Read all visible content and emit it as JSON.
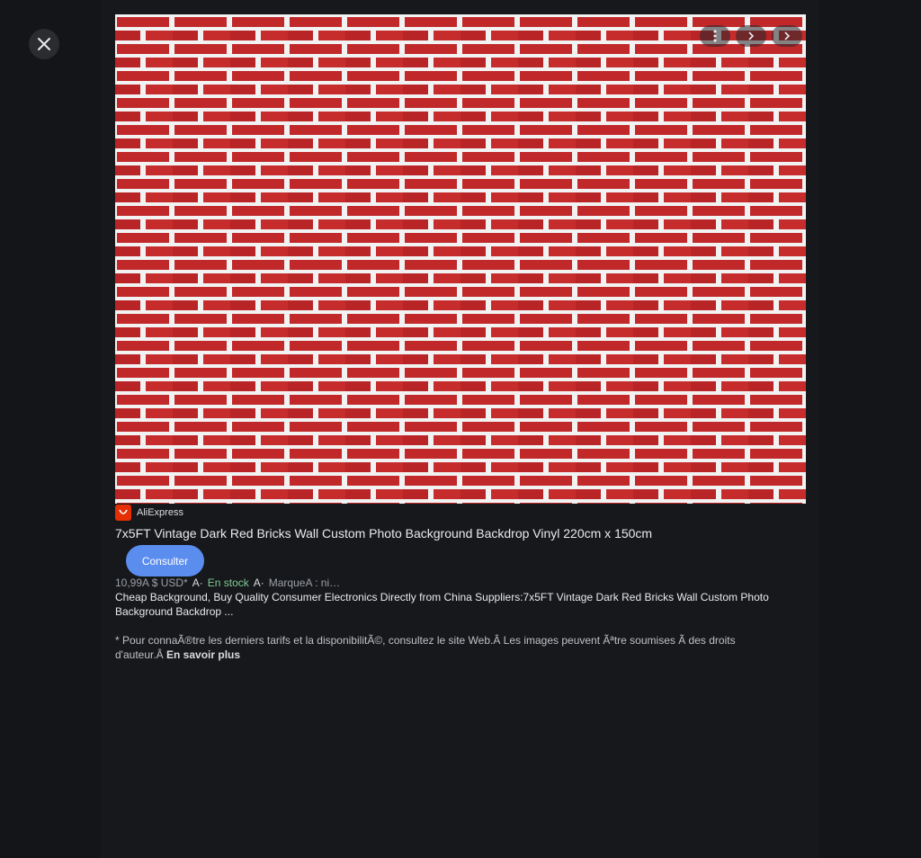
{
  "viewer": {
    "close_icon": "close-icon",
    "image_controls": [
      {
        "name": "more-options",
        "icon": "vertical-dots-icon"
      },
      {
        "name": "share",
        "icon": "chevron-right-icon"
      },
      {
        "name": "next",
        "icon": "chevron-right-icon"
      }
    ]
  },
  "result": {
    "source": "AliExpress",
    "source_icon": "aliexpress-logo-icon",
    "title": "7x5FT Vintage Dark Red Bricks Wall Custom Photo Background Backdrop Vinyl 220cm x 150cm",
    "visit_label": "Consulter",
    "price": "10,99A $ USD*",
    "sep1": "A·",
    "stock": "En stock",
    "sep2": "A·",
    "brand": "MarqueA : ni…",
    "description": "Cheap Background, Buy Quality Consumer Electronics Directly from China Suppliers:7x5FT Vintage Dark Red Bricks Wall Custom Photo Background Backdrop ...",
    "disclaimer": "* Pour connaÃ®tre les derniers tarifs et la disponibilitÃ©, consultez le site Web.Â Les images peuvent Ãªtre soumises Ã  des droits d'auteur.Â ",
    "learn_more": "En savoir plus"
  },
  "colors": {
    "background": "#141518",
    "panel": "#17181b",
    "brick": "#c0282a",
    "mortar": "#f2f2f2",
    "accent_button": "#5b8def",
    "stock": "#81c995"
  }
}
